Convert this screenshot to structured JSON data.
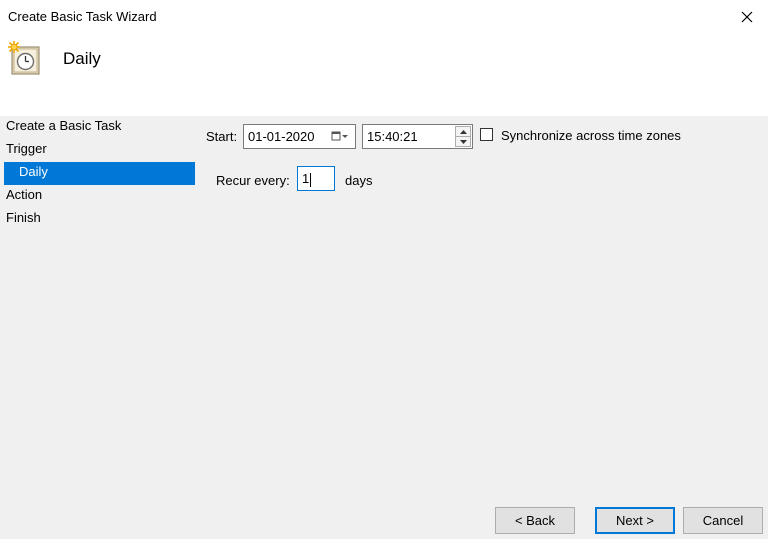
{
  "window": {
    "title": "Create Basic Task Wizard",
    "page_heading": "Daily"
  },
  "steps": [
    {
      "label": "Create a Basic Task",
      "active": false,
      "sub": false
    },
    {
      "label": "Trigger",
      "active": false,
      "sub": false
    },
    {
      "label": "Daily",
      "active": true,
      "sub": true
    },
    {
      "label": "Action",
      "active": false,
      "sub": false
    },
    {
      "label": "Finish",
      "active": false,
      "sub": false
    }
  ],
  "form": {
    "start_label": "Start:",
    "start_date": "01-01-2020",
    "start_time": "15:40:21",
    "sync_label": "Synchronize across time zones",
    "sync_checked": false,
    "recur_label": "Recur every:",
    "recur_value": "1",
    "recur_unit": "days"
  },
  "buttons": {
    "back": "< Back",
    "next": "Next >",
    "cancel": "Cancel"
  },
  "colors": {
    "accent": "#0078d7",
    "content_bg": "#f0f0f0",
    "header_bg": "#ffffff"
  },
  "icons": {
    "close": "close-icon",
    "task": "scheduled-task-clock-icon",
    "date_dropdown": "calendar-dropdown-icon",
    "spin_up": "chevron-up-icon",
    "spin_down": "chevron-down-icon"
  }
}
